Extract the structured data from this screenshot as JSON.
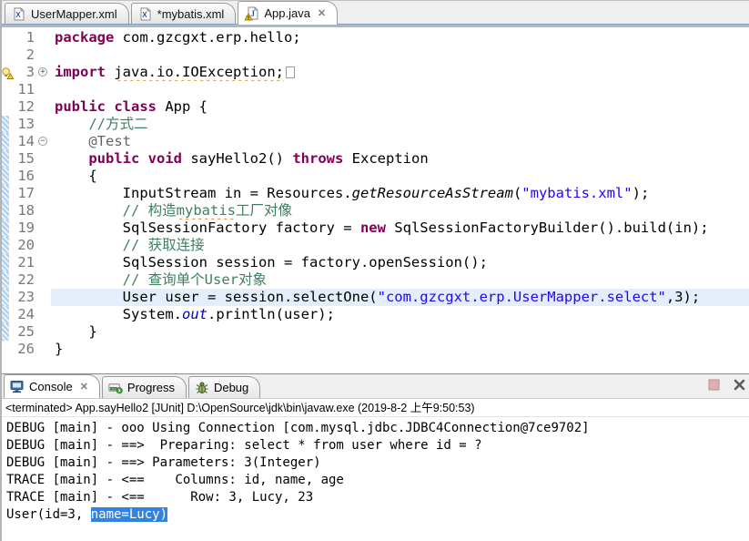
{
  "editor_tabs": [
    {
      "label": "UserMapper.xml",
      "icon": "xml-file-icon",
      "active": false,
      "closable": false
    },
    {
      "label": "*mybatis.xml",
      "icon": "xml-file-icon",
      "active": false,
      "closable": false
    },
    {
      "label": "App.java",
      "icon": "java-file-warning-icon",
      "active": true,
      "closable": true
    }
  ],
  "glyphs": {
    "tab_close": "✕",
    "fold_plus": "+",
    "fold_minus": "−"
  },
  "editor": {
    "lines": [
      {
        "num": "1",
        "segs": [
          {
            "t": "package",
            "c": "kw"
          },
          {
            "t": " com.gzcgxt.erp.hello;",
            "c": "pl"
          }
        ]
      },
      {
        "num": "2",
        "segs": []
      },
      {
        "num": "3",
        "fold": "plus",
        "warn": true,
        "foldbox": true,
        "segs": [
          {
            "t": "import",
            "c": "kw"
          },
          {
            "t": " ",
            "c": "pl"
          },
          {
            "t": "java.io.IOException;",
            "c": "pl warn"
          }
        ]
      },
      {
        "num": "11",
        "segs": []
      },
      {
        "num": "12",
        "segs": [
          {
            "t": "public",
            "c": "kw"
          },
          {
            "t": " ",
            "c": "pl"
          },
          {
            "t": "class",
            "c": "kw"
          },
          {
            "t": " App {",
            "c": "pl"
          }
        ]
      },
      {
        "num": "13",
        "changed": true,
        "segs": [
          {
            "t": "    ",
            "c": "pl"
          },
          {
            "t": "//方式二",
            "c": "com"
          }
        ]
      },
      {
        "num": "14",
        "changed": true,
        "fold": "minus",
        "segs": [
          {
            "t": "    ",
            "c": "pl"
          },
          {
            "t": "@Test",
            "c": "ann"
          }
        ]
      },
      {
        "num": "15",
        "changed": true,
        "segs": [
          {
            "t": "    ",
            "c": "pl"
          },
          {
            "t": "public",
            "c": "kw"
          },
          {
            "t": " ",
            "c": "pl"
          },
          {
            "t": "void",
            "c": "kw"
          },
          {
            "t": " sayHello2() ",
            "c": "pl"
          },
          {
            "t": "throws",
            "c": "kw"
          },
          {
            "t": " Exception",
            "c": "pl"
          }
        ]
      },
      {
        "num": "16",
        "changed": true,
        "segs": [
          {
            "t": "    {",
            "c": "pl"
          }
        ]
      },
      {
        "num": "17",
        "changed": true,
        "segs": [
          {
            "t": "        InputStream in = Resources.",
            "c": "pl"
          },
          {
            "t": "getResourceAsStream",
            "c": "sm"
          },
          {
            "t": "(",
            "c": "pl"
          },
          {
            "t": "\"mybatis.xml\"",
            "c": "str"
          },
          {
            "t": ");",
            "c": "pl"
          }
        ]
      },
      {
        "num": "18",
        "changed": true,
        "segs": [
          {
            "t": "        ",
            "c": "pl"
          },
          {
            "t": "// 构造",
            "c": "com"
          },
          {
            "t": "mybatis",
            "c": "com spell"
          },
          {
            "t": "工厂对像",
            "c": "com"
          }
        ]
      },
      {
        "num": "19",
        "changed": true,
        "segs": [
          {
            "t": "        SqlSessionFactory factory = ",
            "c": "pl"
          },
          {
            "t": "new",
            "c": "kw"
          },
          {
            "t": " SqlSessionFactoryBuilder().build(in);",
            "c": "pl"
          }
        ]
      },
      {
        "num": "20",
        "changed": true,
        "segs": [
          {
            "t": "        ",
            "c": "pl"
          },
          {
            "t": "// 获取连接",
            "c": "com"
          }
        ]
      },
      {
        "num": "21",
        "changed": true,
        "segs": [
          {
            "t": "        SqlSession session = factory.openSession();",
            "c": "pl"
          }
        ]
      },
      {
        "num": "22",
        "changed": true,
        "segs": [
          {
            "t": "        ",
            "c": "pl"
          },
          {
            "t": "// 查询单个User对象",
            "c": "com"
          }
        ]
      },
      {
        "num": "23",
        "changed": true,
        "current": true,
        "segs": [
          {
            "t": "        User user = session.selectOne(",
            "c": "pl"
          },
          {
            "t": "\"com.gzcgxt.erp.UserMapper.select\"",
            "c": "str"
          },
          {
            "t": ",3);",
            "c": "pl"
          }
        ]
      },
      {
        "num": "24",
        "changed": true,
        "segs": [
          {
            "t": "        System.",
            "c": "pl"
          },
          {
            "t": "out",
            "c": "sf"
          },
          {
            "t": ".println(user);",
            "c": "pl"
          }
        ]
      },
      {
        "num": "25",
        "changed": true,
        "segs": [
          {
            "t": "    }",
            "c": "pl"
          }
        ]
      },
      {
        "num": "26",
        "segs": [
          {
            "t": "}",
            "c": "pl"
          }
        ]
      }
    ]
  },
  "console": {
    "tabs": [
      {
        "label": "Console",
        "icon": "console-icon",
        "active": true,
        "closable": true
      },
      {
        "label": "Progress",
        "icon": "progress-icon",
        "active": false,
        "closable": false
      },
      {
        "label": "Debug",
        "icon": "debug-icon",
        "active": false,
        "closable": false
      }
    ],
    "status": "<terminated> App.sayHello2 [JUnit] D:\\OpenSource\\jdk\\bin\\javaw.exe (2019-8-2 上午9:50:53)",
    "output": [
      {
        "segs": [
          {
            "t": "DEBUG [main] - ooo Using Connection [com.mysql.jdbc.JDBC4Connection@7ce9702]"
          }
        ]
      },
      {
        "segs": [
          {
            "t": "DEBUG [main] - ==>  Preparing: select * from user where id = ?"
          }
        ]
      },
      {
        "segs": [
          {
            "t": "DEBUG [main] - ==> Parameters: 3(Integer)"
          }
        ]
      },
      {
        "segs": [
          {
            "t": "TRACE [main] - <==    Columns: id, name, age"
          }
        ]
      },
      {
        "segs": [
          {
            "t": "TRACE [main] - <==      Row: 3, Lucy, 23"
          }
        ]
      },
      {
        "segs": [
          {
            "t": "User(id=3, "
          },
          {
            "t": "name=Lucy)",
            "c": "sel"
          }
        ]
      }
    ]
  }
}
